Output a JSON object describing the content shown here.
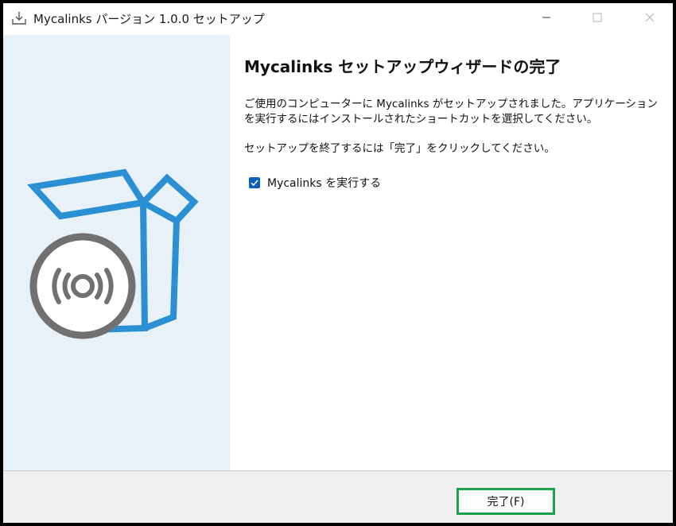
{
  "window": {
    "title": "Mycalinks パージョン 1.0.0 セットアップ",
    "icons": {
      "app": "installer-download-icon",
      "minimize": "minimize-icon",
      "maximize": "maximize-icon",
      "close": "close-icon"
    }
  },
  "banner": {
    "illustration": "software-box-with-disc-icon",
    "colors": {
      "box": "#2a8fd3",
      "disc": "#707070",
      "background": "#e8f0f8"
    }
  },
  "content": {
    "heading": "Mycalinks セットアップウィザードの完了",
    "paragraph1": "ご使用のコンピューターに Mycalinks がセットアップされました。アプリケーションを実行するにはインストールされたショートカットを選択してください。",
    "paragraph2": "セットアップを終了するには「完了」をクリックしてください。",
    "run_checkbox": {
      "label": "Mycalinks を実行する",
      "checked": true
    }
  },
  "footer": {
    "finish_label": "完了(F)",
    "finish_highlight_color": "#1aa34a"
  }
}
